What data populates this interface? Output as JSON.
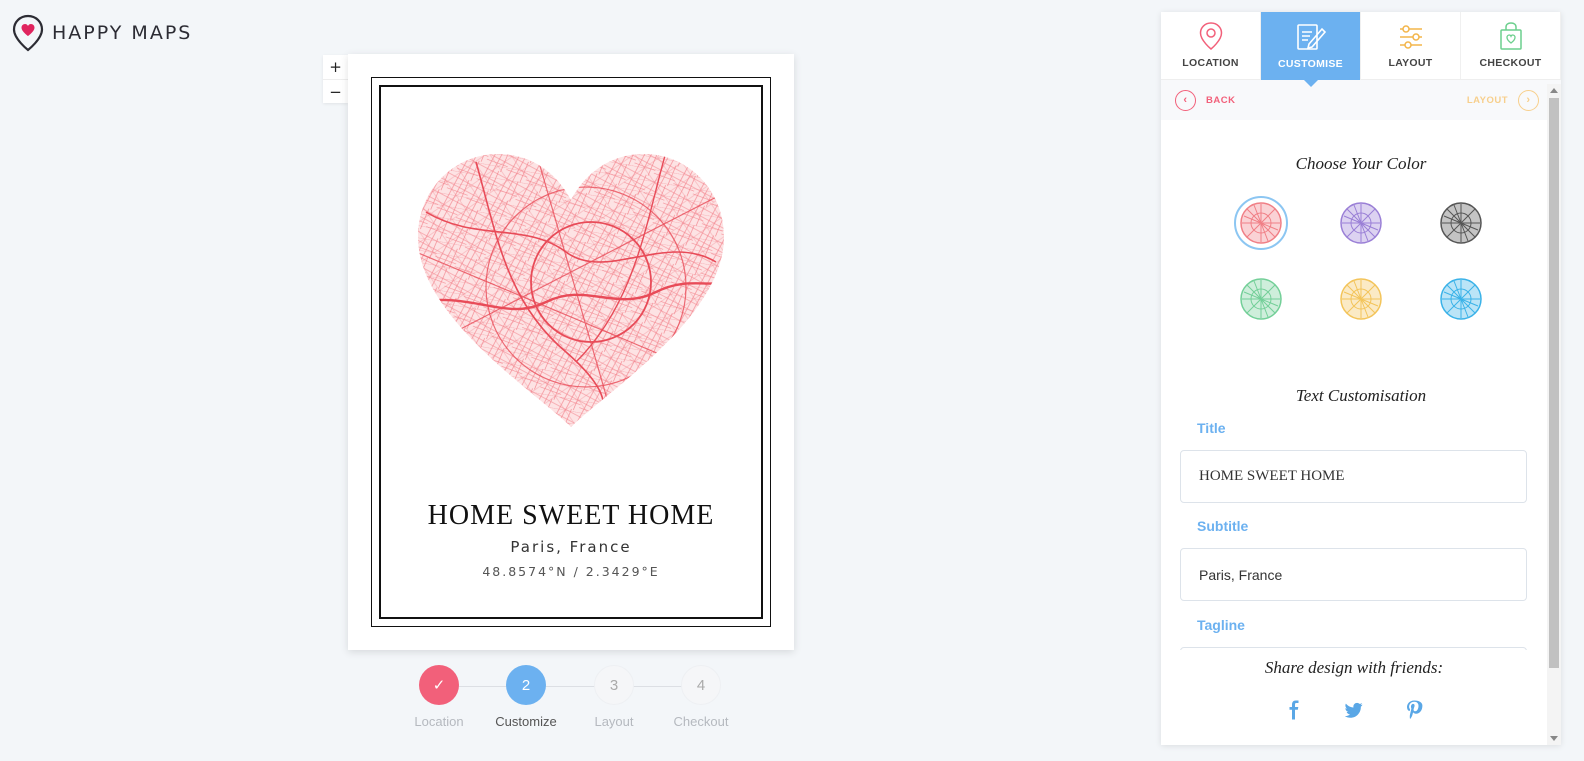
{
  "brand": {
    "name": "HAPPY MAPS",
    "accent": "#f2607a",
    "primary": "#6cb1f0"
  },
  "zoom": {
    "in_label": "+",
    "out_label": "−"
  },
  "poster": {
    "title": "HOME SWEET HOME",
    "subtitle": "Paris, France",
    "tagline": "48.8574°N / 2.3429°E",
    "map_color": "#f4787f"
  },
  "stepper": {
    "steps": [
      {
        "number": "✓",
        "label": "Location",
        "state": "done"
      },
      {
        "number": "2",
        "label": "Customize",
        "state": "active"
      },
      {
        "number": "3",
        "label": "Layout",
        "state": "todo"
      },
      {
        "number": "4",
        "label": "Checkout",
        "state": "todo"
      }
    ]
  },
  "tabs": [
    {
      "label": "LOCATION",
      "icon": "location-pin-icon",
      "active": false
    },
    {
      "label": "CUSTOMISE",
      "icon": "edit-document-icon",
      "active": true
    },
    {
      "label": "LAYOUT",
      "icon": "sliders-icon",
      "active": false
    },
    {
      "label": "CHECKOUT",
      "icon": "shopping-bag-icon",
      "active": false
    }
  ],
  "nav": {
    "back_label": "BACK",
    "next_label": "LAYOUT"
  },
  "color_section": {
    "heading": "Choose Your Color",
    "swatches": [
      {
        "name": "red",
        "color": "#f07f86",
        "selected": true
      },
      {
        "name": "purple",
        "color": "#9a7fd6",
        "selected": false
      },
      {
        "name": "black",
        "color": "#555555",
        "selected": false
      },
      {
        "name": "green",
        "color": "#73cf98",
        "selected": false
      },
      {
        "name": "yellow",
        "color": "#f3c45a",
        "selected": false
      },
      {
        "name": "blue",
        "color": "#3ab2e8",
        "selected": false
      }
    ]
  },
  "text_section": {
    "heading": "Text Customisation",
    "title_label": "Title",
    "title_value": "HOME SWEET HOME",
    "subtitle_label": "Subtitle",
    "subtitle_value": "Paris, France",
    "tagline_label": "Tagline",
    "tagline_value": ""
  },
  "share": {
    "heading": "Share design with friends:",
    "networks": [
      "facebook-icon",
      "twitter-icon",
      "pinterest-icon"
    ]
  }
}
